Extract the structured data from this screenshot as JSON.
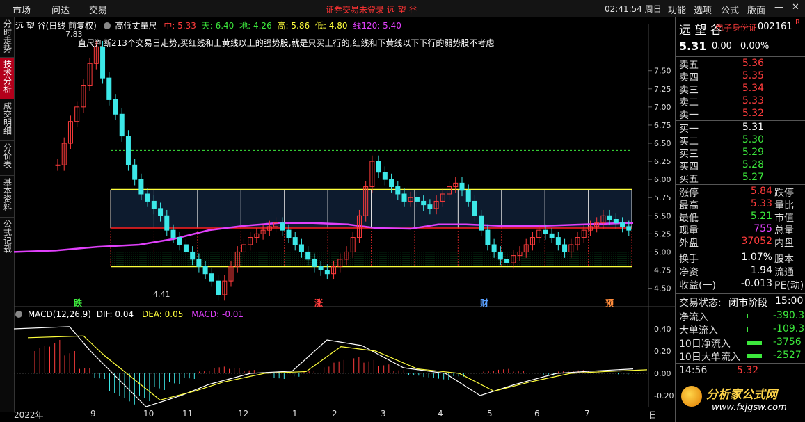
{
  "topbar": {
    "menu": [
      "市场",
      "问达",
      "交易"
    ],
    "notice": "证券交易未登录  远 望 谷",
    "clock": "02:41:54 周日",
    "right_menu": [
      "功能",
      "选项",
      "公式",
      "版面"
    ]
  },
  "side_tabs": [
    "分时走势",
    "技术分析",
    "成交明细",
    "分价表",
    "基本资料",
    "公式记载"
  ],
  "active_side_tab": 1,
  "legend": {
    "title": "远 望 谷(日线 前复权)",
    "indicator": "高低丈量尺",
    "items": [
      {
        "label": "中: 5.33",
        "color": "#ff3c3c"
      },
      {
        "label": "天: 6.40",
        "color": "#3ce83c"
      },
      {
        "label": "地: 4.26",
        "color": "#3ce83c"
      },
      {
        "label": "高: 5.86",
        "color": "#ffff3c"
      },
      {
        "label": "低: 4.80",
        "color": "#ffff3c"
      },
      {
        "label": "线120: 5.40",
        "color": "#e040fb"
      }
    ]
  },
  "annotation": "直尺判断213个交易日走势,买红线和上黄线以上的强势股,就是只买上行的,红线和下黄线以下下行的弱势股不考虑",
  "price_marks": {
    "high": "7.83",
    "low": "4.41"
  },
  "event_markers": [
    "跌",
    "涨",
    "财",
    "预"
  ],
  "macd_legend": {
    "title": "MACD(12,26,9)",
    "dif": "DIF: 0.04",
    "dea": "DEA: 0.05",
    "macd": "MACD: -0.01"
  },
  "chart_data": {
    "type": "candlestick",
    "price_ticks": [
      "7.50",
      "7.25",
      "7.00",
      "6.75",
      "6.50",
      "6.25",
      "6.00",
      "5.75",
      "5.50",
      "5.25",
      "5.00",
      "4.75",
      "4.50"
    ],
    "macd_ticks": [
      "0.40",
      "0.20",
      "0.00",
      "-0.20"
    ],
    "x_labels": [
      "2022年",
      "9",
      "10",
      "11",
      "12",
      "1",
      "2",
      "3",
      "4",
      "5",
      "6",
      "7",
      "日"
    ],
    "levels": {
      "mid": 5.33,
      "sky": 6.4,
      "ground": 4.26,
      "upper": 5.86,
      "lower": 4.8
    },
    "ylim": [
      4.4,
      7.9
    ]
  },
  "quote": {
    "name": "远 望 谷",
    "tag": "电子身份证",
    "code": "002161",
    "flag": "R",
    "price": "5.31",
    "change": "0.00",
    "pct": "0.00%",
    "asks": [
      {
        "label": "卖五",
        "price": "5.36"
      },
      {
        "label": "卖四",
        "price": "5.35"
      },
      {
        "label": "卖三",
        "price": "5.34"
      },
      {
        "label": "卖二",
        "price": "5.33"
      },
      {
        "label": "卖一",
        "price": "5.32"
      }
    ],
    "bids": [
      {
        "label": "买一",
        "price": "5.31"
      },
      {
        "label": "买二",
        "price": "5.30"
      },
      {
        "label": "买三",
        "price": "5.29"
      },
      {
        "label": "买四",
        "price": "5.28"
      },
      {
        "label": "买五",
        "price": "5.27"
      }
    ],
    "stats": [
      {
        "label": "涨停",
        "value": "5.84",
        "label2": "跌停"
      },
      {
        "label": "最高",
        "value": "5.33",
        "label2": "量比"
      },
      {
        "label": "最低",
        "value": "5.21",
        "label2": "市值"
      },
      {
        "label": "现量",
        "value": "755",
        "label2": "总量"
      },
      {
        "label": "外盘",
        "value": "37052",
        "label2": "内盘"
      }
    ],
    "stats2": [
      {
        "label": "换手",
        "value": "1.07%",
        "label2": "股本"
      },
      {
        "label": "净资",
        "value": "1.94",
        "label2": "流通"
      },
      {
        "label": "收益(一)",
        "value": "-0.013",
        "label2": "PE(动)"
      }
    ],
    "trade_state_label": "交易状态:",
    "trade_state": "闭市阶段",
    "trade_time": "15:00",
    "flows": [
      {
        "label": "净流入",
        "value": "-390.3"
      },
      {
        "label": "大单流入",
        "value": "-109.3"
      },
      {
        "label": "10日净流入",
        "value": "-3756"
      },
      {
        "label": "10日大单流入",
        "value": "-2527"
      }
    ],
    "tick": {
      "time": "14:56",
      "price": "5.32"
    }
  },
  "watermark": {
    "text": "分析家公式网",
    "url": "www.fxjgsw.com"
  }
}
